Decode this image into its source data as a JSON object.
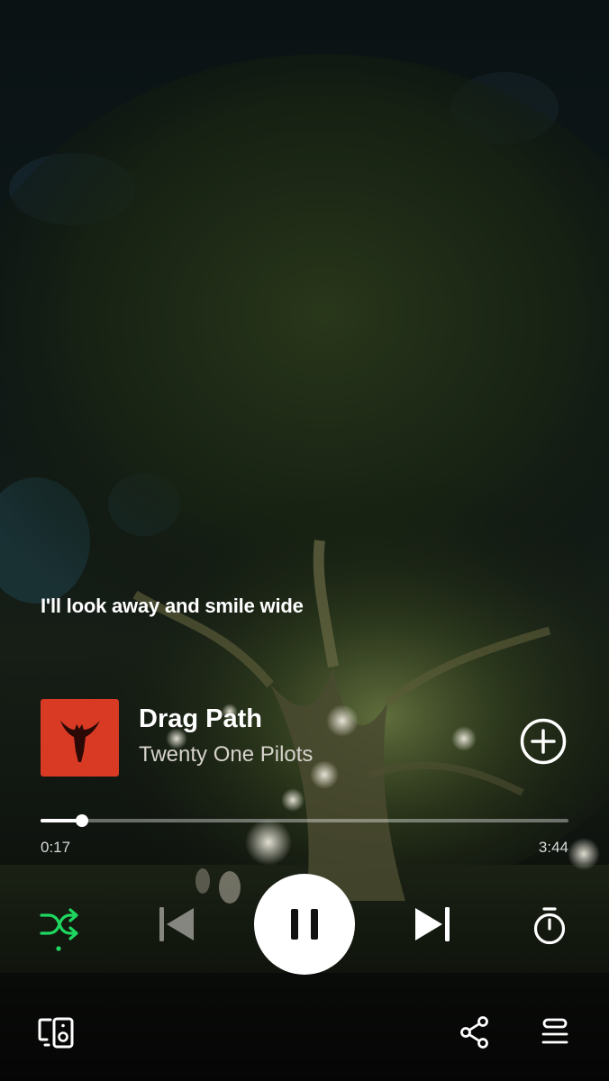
{
  "lyrics": {
    "current_line": "I'll look away and smile wide"
  },
  "track": {
    "title": "Drag Path",
    "artist": "Twenty One Pilots",
    "album_art_color": "#d83a24"
  },
  "playback": {
    "elapsed": "0:17",
    "duration": "3:44",
    "progress_fraction": 0.0785,
    "state": "playing",
    "shuffle_enabled": true
  },
  "icons": {
    "add": "plus-circle-icon",
    "shuffle": "shuffle-icon",
    "previous": "skip-previous-icon",
    "pause": "pause-icon",
    "next": "skip-next-icon",
    "timer": "sleep-timer-icon",
    "devices": "connect-device-icon",
    "share": "share-icon",
    "queue": "queue-icon"
  },
  "colors": {
    "accent": "#1ed760",
    "text": "#ffffff",
    "subtext": "#d6d3cc"
  }
}
